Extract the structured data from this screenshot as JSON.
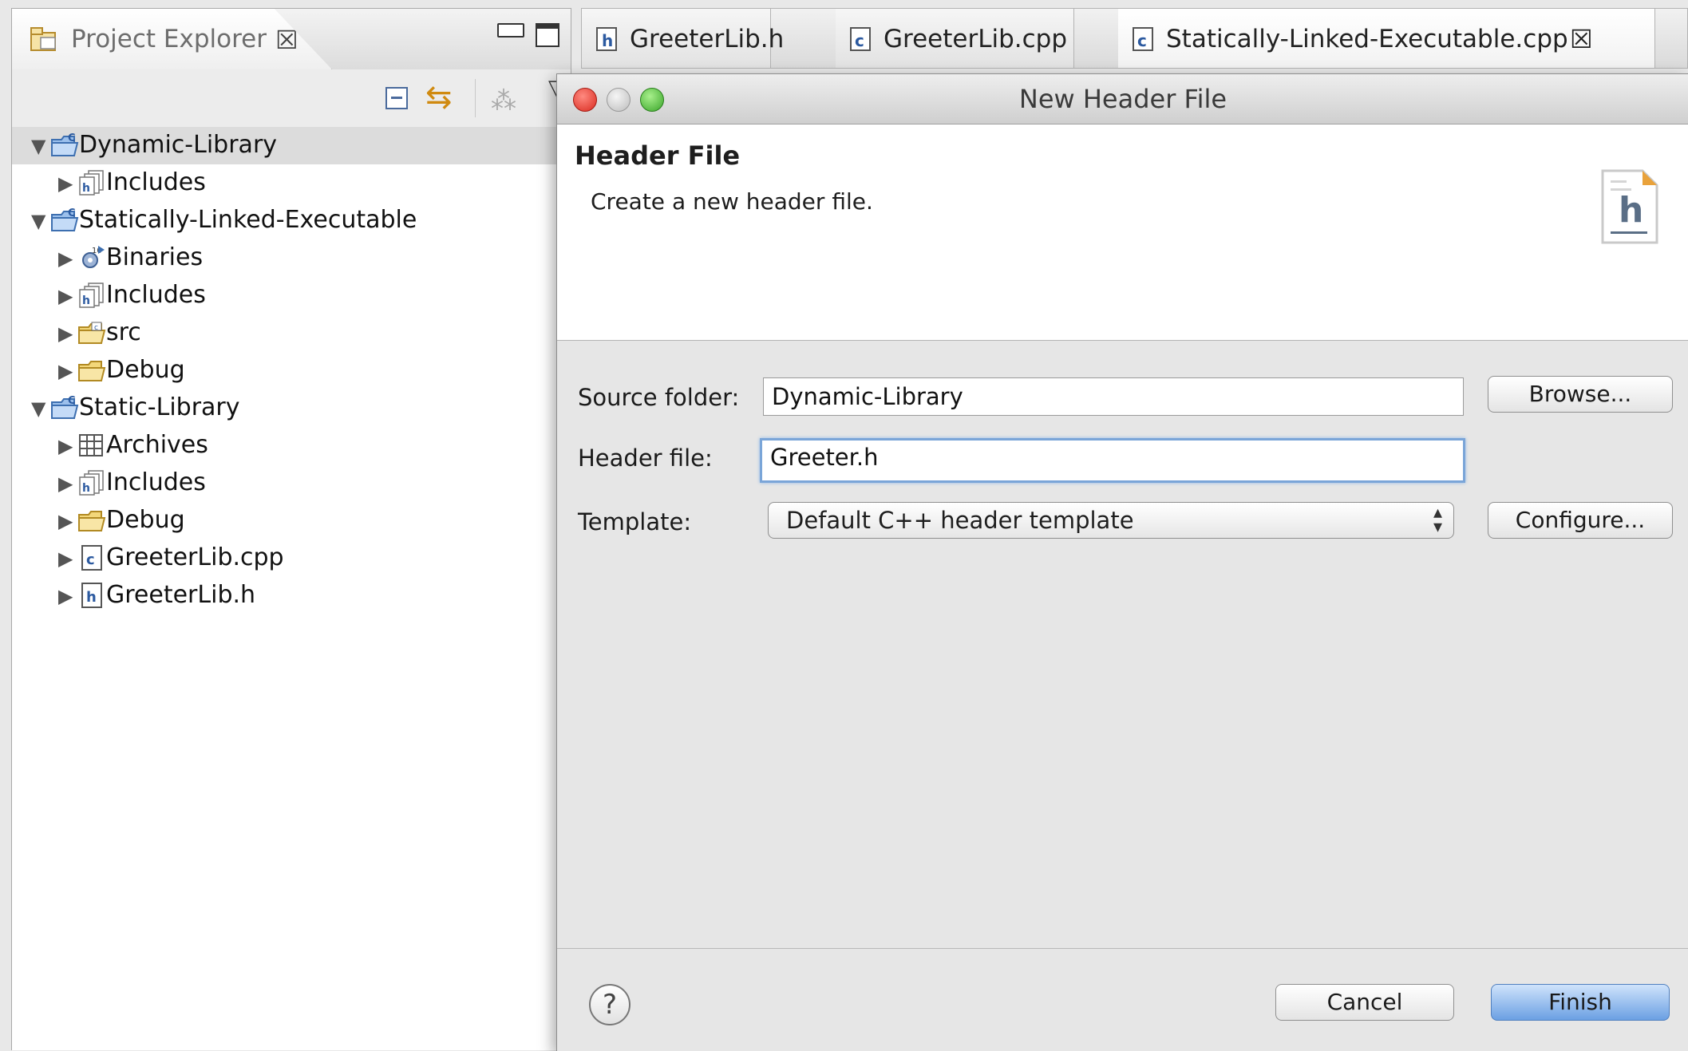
{
  "explorer": {
    "tab_label": "Project Explorer",
    "tab_close": "☒",
    "tree": [
      {
        "label": "Dynamic-Library",
        "icon": "c-project-folder-icon",
        "arrow": "▼",
        "level": 0,
        "selected": true
      },
      {
        "label": "Includes",
        "icon": "includes-icon",
        "arrow": "▶",
        "level": 1
      },
      {
        "label": "Statically-Linked-Executable",
        "icon": "c-project-folder-icon",
        "arrow": "▼",
        "level": 0
      },
      {
        "label": "Binaries",
        "icon": "binaries-icon",
        "arrow": "▶",
        "level": 1
      },
      {
        "label": "Includes",
        "icon": "includes-icon",
        "arrow": "▶",
        "level": 1
      },
      {
        "label": "src",
        "icon": "source-folder-icon",
        "arrow": "▶",
        "level": 1
      },
      {
        "label": "Debug",
        "icon": "folder-icon",
        "arrow": "▶",
        "level": 1
      },
      {
        "label": "Static-Library",
        "icon": "c-project-folder-icon",
        "arrow": "▼",
        "level": 0
      },
      {
        "label": "Archives",
        "icon": "archives-icon",
        "arrow": "▶",
        "level": 1
      },
      {
        "label": "Includes",
        "icon": "includes-icon",
        "arrow": "▶",
        "level": 1
      },
      {
        "label": "Debug",
        "icon": "folder-icon",
        "arrow": "▶",
        "level": 1
      },
      {
        "label": "GreeterLib.cpp",
        "icon": "cpp-file-icon",
        "arrow": "▶",
        "level": 1
      },
      {
        "label": "GreeterLib.h",
        "icon": "header-file-icon",
        "arrow": "▶",
        "level": 1
      }
    ]
  },
  "editor_tabs": [
    {
      "label": "GreeterLib.h",
      "icon": "header-file-icon"
    },
    {
      "label": "GreeterLib.cpp",
      "icon": "cpp-file-icon"
    },
    {
      "label": "Statically-Linked-Executable.cpp",
      "icon": "cpp-file-icon",
      "close": "☒",
      "active": true
    }
  ],
  "dialog": {
    "title": "New Header File",
    "banner_title": "Header File",
    "banner_desc": "Create a new header file.",
    "banner_icon_letter": "h",
    "source_folder_label": "Source folder:",
    "source_folder_value": "Dynamic-Library",
    "browse_label": "Browse...",
    "header_file_label": "Header file:",
    "header_file_value": "Greeter.h",
    "template_label": "Template:",
    "template_value": "Default C++ header template",
    "configure_label": "Configure...",
    "help_symbol": "?",
    "cancel_label": "Cancel",
    "finish_label": "Finish"
  }
}
